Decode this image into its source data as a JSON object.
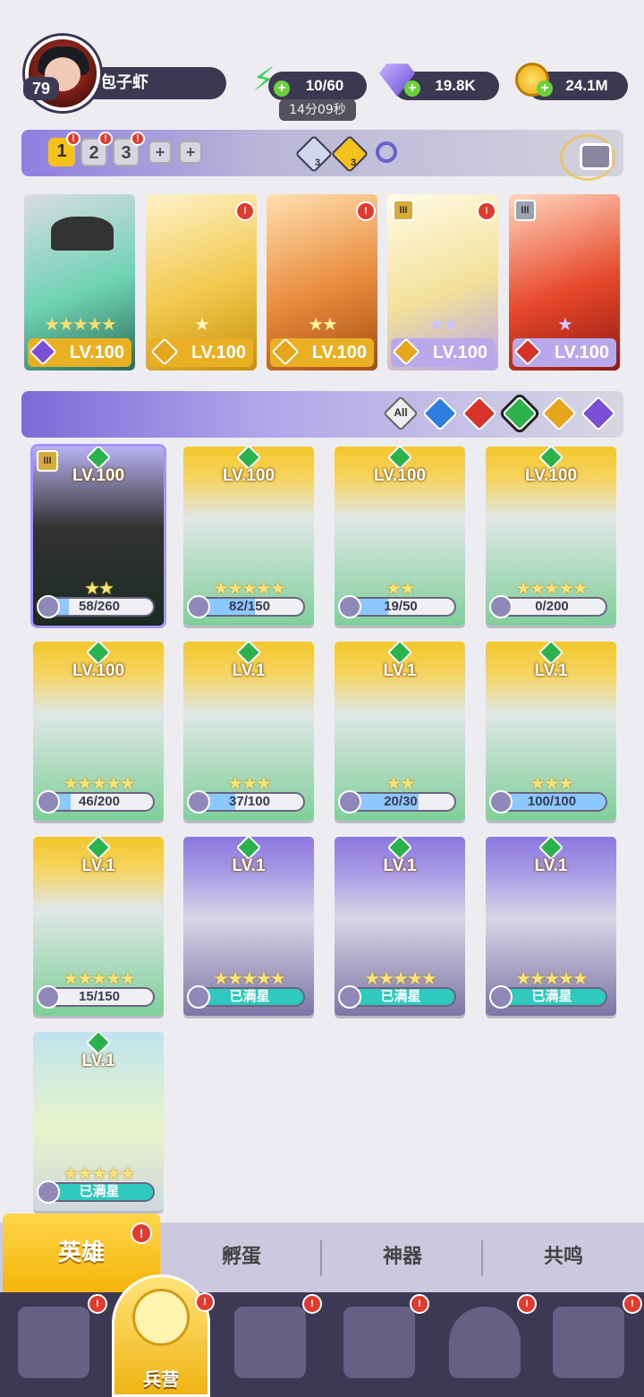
{
  "player": {
    "level": "79",
    "name": "包子虾"
  },
  "resources": {
    "energy": "10/60",
    "energy_timer": "14分09秒",
    "gems": "19.8K",
    "gold": "24.1M"
  },
  "teams": {
    "slots": [
      "1",
      "2",
      "3"
    ],
    "active_slot": "1",
    "badge": "!",
    "counts": [
      "3",
      "3"
    ]
  },
  "team_cards": [
    {
      "level": "LV.100",
      "stars": "★★★★★",
      "element_color": "#7a4fd6"
    },
    {
      "level": "LV.100",
      "stars": "★",
      "element_color": "#e6a51c"
    },
    {
      "level": "LV.100",
      "stars": "★★",
      "element_color": "#e6a51c"
    },
    {
      "level": "LV.100",
      "stars": "★★",
      "element_color": "#e6a51c"
    },
    {
      "level": "LV.100",
      "stars": "★",
      "element_color": "#d8322a"
    }
  ],
  "filter": {
    "all_label": "All",
    "colors": [
      "#2f7fe0",
      "#d8322a",
      "#2bb24c",
      "#e6a51c",
      "#7a4fd6"
    ],
    "selected": 3
  },
  "heroes": [
    {
      "level": "LV.100",
      "stars": "★★",
      "progress": "58/260",
      "ratio": 0.22,
      "full": false
    },
    {
      "level": "LV.100",
      "stars": "★★★★★",
      "progress": "82/150",
      "ratio": 0.55,
      "full": false
    },
    {
      "level": "LV.100",
      "stars": "★★",
      "progress": "19/50",
      "ratio": 0.38,
      "full": false
    },
    {
      "level": "LV.100",
      "stars": "★★★★★",
      "progress": "0/200",
      "ratio": 0.0,
      "full": false
    },
    {
      "level": "LV.100",
      "stars": "★★★★★",
      "progress": "46/200",
      "ratio": 0.23,
      "full": false
    },
    {
      "level": "LV.1",
      "stars": "★★★",
      "progress": "37/100",
      "ratio": 0.37,
      "full": false
    },
    {
      "level": "LV.1",
      "stars": "★★",
      "progress": "20/30",
      "ratio": 0.67,
      "full": false
    },
    {
      "level": "LV.1",
      "stars": "★★★",
      "progress": "100/100",
      "ratio": 1.0,
      "full": false
    },
    {
      "level": "LV.1",
      "stars": "★★★★★",
      "progress": "15/150",
      "ratio": 0.1,
      "full": false
    },
    {
      "level": "LV.1",
      "stars": "★★★★★",
      "progress": "已满星",
      "ratio": 1.0,
      "full": true
    },
    {
      "level": "LV.1",
      "stars": "★★★★★",
      "progress": "已满星",
      "ratio": 1.0,
      "full": true
    },
    {
      "level": "LV.1",
      "stars": "★★★★★",
      "progress": "已满星",
      "ratio": 1.0,
      "full": true
    },
    {
      "level": "LV.1",
      "stars": "★★★★★",
      "progress": "已满星",
      "ratio": 1.0,
      "full": true
    }
  ],
  "subtabs": [
    "英雄",
    "孵蛋",
    "神器",
    "共鸣"
  ],
  "nav": {
    "active_label": "兵营"
  }
}
